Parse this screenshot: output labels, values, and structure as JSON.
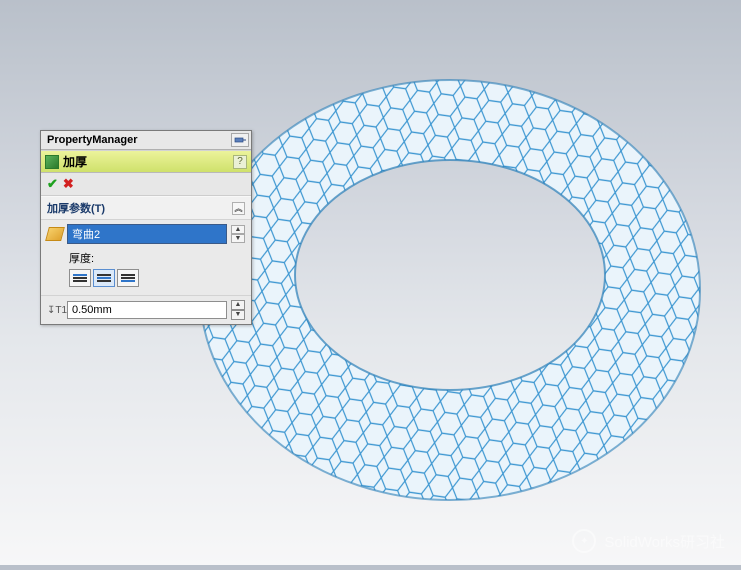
{
  "panel": {
    "title": "PropertyManager",
    "feature": {
      "name": "加厚",
      "help": "?"
    },
    "group": {
      "header": "加厚参数(T)",
      "selection": "弯曲2",
      "thickness_label": "厚度:",
      "thickness_value": "0.50mm"
    }
  },
  "watermark": "SolidWorks研习社"
}
